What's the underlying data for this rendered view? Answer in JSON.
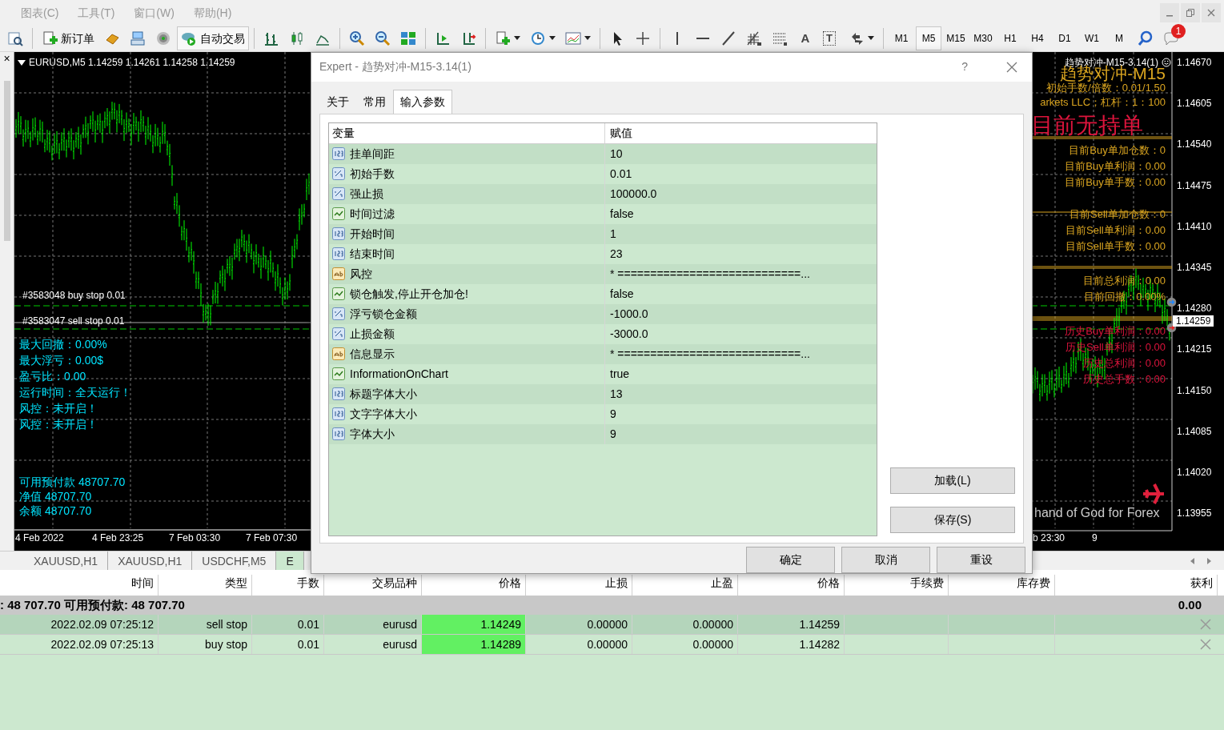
{
  "menu": [
    {
      "label": "图表(C)",
      "disabled": true
    },
    {
      "label": "工具(T)",
      "disabled": true
    },
    {
      "label": "窗口(W)",
      "disabled": true
    },
    {
      "label": "帮助(H)",
      "disabled": true
    }
  ],
  "toolbar": {
    "new_order": "新订单",
    "auto_trading": {
      "label": "自动交易",
      "on": true
    },
    "text_tool": "A",
    "text_label_tool": "T",
    "timeframes": [
      {
        "label": "M1",
        "selected": false
      },
      {
        "label": "M5",
        "selected": true
      },
      {
        "label": "M15",
        "selected": false
      },
      {
        "label": "M30",
        "selected": false
      },
      {
        "label": "H1",
        "selected": false
      },
      {
        "label": "H4",
        "selected": false
      },
      {
        "label": "D1",
        "selected": false
      },
      {
        "label": "W1",
        "selected": false
      },
      {
        "label": "M",
        "selected": false
      }
    ],
    "notification_count": "1"
  },
  "navigator_close": "×",
  "left_chart": {
    "header": "EURUSD,M5  1.14259 1.14261 1.14258 1.14259",
    "order_labels": [
      "#3583048 buy stop 0.01",
      "#3583047 sell stop 0.01"
    ],
    "info_lines": [
      "最大回撤：0.00%",
      "最大浮亏：0.00$",
      "盈亏比：0.00",
      "运行时间：全天运行！",
      "风控：未开启！",
      "风控：未开启！"
    ],
    "account_lines": [
      "可用预付款 48707.70",
      "净值 48707.70",
      "余额 48707.70"
    ],
    "time_labels": [
      "4 Feb 2022",
      "4 Feb 23:25",
      "7 Feb 03:30",
      "7 Feb 07:30"
    ]
  },
  "right_chart": {
    "title": "趋势对冲-M15-3.14(1)",
    "panel_lines": [
      {
        "text": "趋势对冲-M15",
        "color": "#daa520",
        "kind": "large"
      },
      {
        "text": "初始手数/倍数：0.01/1.50",
        "color": "#daa520",
        "kind": "normal"
      },
      {
        "text": "arkets LLC；杠杆：1：100",
        "color": "#daa520",
        "kind": "normal"
      },
      {
        "text": "目前无持单",
        "color": "#dc143c",
        "kind": "huge"
      },
      {
        "text": "目前Buy单加仓数：0",
        "color": "#daa520",
        "kind": "normal"
      },
      {
        "text": "目前Buy单利润：0.00",
        "color": "#daa520",
        "kind": "normal"
      },
      {
        "text": "目前Buy单手数：0.00",
        "color": "#daa520",
        "kind": "normal"
      },
      {
        "text": "目前Sell单加仓数：0",
        "color": "#daa520",
        "kind": "normal"
      },
      {
        "text": "目前Sell单利润：0.00",
        "color": "#daa520",
        "kind": "normal"
      },
      {
        "text": "目前Sell单手数：0.00",
        "color": "#daa520",
        "kind": "normal"
      },
      {
        "text": "目前总利润：0.00",
        "color": "#daa520",
        "kind": "normal"
      },
      {
        "text": "目前回撤：0.00%",
        "color": "#daa520",
        "kind": "normal"
      },
      {
        "text": "历史Buy单利润：0.00",
        "color": "#dc143c",
        "kind": "normal"
      },
      {
        "text": "历史Sell单利润：0.00",
        "color": "#dc143c",
        "kind": "normal"
      },
      {
        "text": "历史总利润：0.00",
        "color": "#dc143c",
        "kind": "normal"
      },
      {
        "text": "历史总手数：0.00",
        "color": "#dc143c",
        "kind": "normal"
      }
    ],
    "footer": "hand of God for Forex",
    "time_labels": [
      "b 23:30",
      "9"
    ],
    "price_labels": [
      "1.14670",
      "1.14605",
      "1.14540",
      "1.14475",
      "1.14410",
      "1.14345",
      "1.14280",
      "1.14215",
      "1.14150",
      "1.14085",
      "1.14020",
      "1.13955"
    ],
    "current_price": "1.14259"
  },
  "dialog": {
    "title": "Expert - 趋势对冲-M15-3.14(1)",
    "help": "?",
    "tabs": [
      {
        "label": "关于",
        "selected": false
      },
      {
        "label": "常用",
        "selected": false
      },
      {
        "label": "输入参数",
        "selected": true
      }
    ],
    "columns": [
      "变量",
      "赋值"
    ],
    "params": [
      {
        "name": "挂单间距",
        "value": "10",
        "kind": "int"
      },
      {
        "name": "初始手数",
        "value": "0.01",
        "kind": "double"
      },
      {
        "name": "强止损",
        "value": "100000.0",
        "kind": "double"
      },
      {
        "name": "时间过滤",
        "value": "false",
        "kind": "bool"
      },
      {
        "name": "开始时间",
        "value": "1",
        "kind": "int"
      },
      {
        "name": "结束时间",
        "value": "23",
        "kind": "int"
      },
      {
        "name": "风控",
        "value": "* ============================...",
        "kind": "string"
      },
      {
        "name": "锁仓触发,停止开仓加仓!",
        "value": "false",
        "kind": "bool"
      },
      {
        "name": "浮亏锁仓金额",
        "value": "-1000.0",
        "kind": "double"
      },
      {
        "name": "止损金额",
        "value": "-3000.0",
        "kind": "double"
      },
      {
        "name": "信息显示",
        "value": "* ============================...",
        "kind": "string"
      },
      {
        "name": "InformationOnChart",
        "value": "true",
        "kind": "bool"
      },
      {
        "name": "标题字体大小",
        "value": "13",
        "kind": "int"
      },
      {
        "name": "文字字体大小",
        "value": "9",
        "kind": "int"
      },
      {
        "name": "字体大小",
        "value": "9",
        "kind": "int"
      }
    ],
    "side_buttons": [
      "加载(L)",
      "保存(S)"
    ],
    "buttons": [
      "确定",
      "取消",
      "重设"
    ]
  },
  "chart_tabs": [
    {
      "label": "XAUUSD,H1",
      "selected": false
    },
    {
      "label": "XAUUSD,H1",
      "selected": false
    },
    {
      "label": "USDCHF,M5",
      "selected": false
    },
    {
      "label": "E",
      "selected": true
    }
  ],
  "terminal": {
    "columns": [
      "时间",
      "类型",
      "手数",
      "交易品种",
      "价格",
      "止损",
      "止盈",
      "价格",
      "手续费",
      "库存费",
      "获利"
    ],
    "summary": {
      "text": ": 48 707.70  可用预付款: 48 707.70",
      "profit": "0.00"
    },
    "rows": [
      {
        "time": "2022.02.09 07:25:12",
        "type": "sell stop",
        "lots": "0.01",
        "symbol": "eurusd",
        "price": "1.14249",
        "stop_loss": "0.00000",
        "take_profit": "0.00000",
        "market_price": "1.14259",
        "selected": true
      },
      {
        "time": "2022.02.09 07:25:13",
        "type": "buy stop",
        "lots": "0.01",
        "symbol": "eurusd",
        "price": "1.14289",
        "stop_loss": "0.00000",
        "take_profit": "0.00000",
        "market_price": "1.14282",
        "selected": false
      }
    ]
  }
}
